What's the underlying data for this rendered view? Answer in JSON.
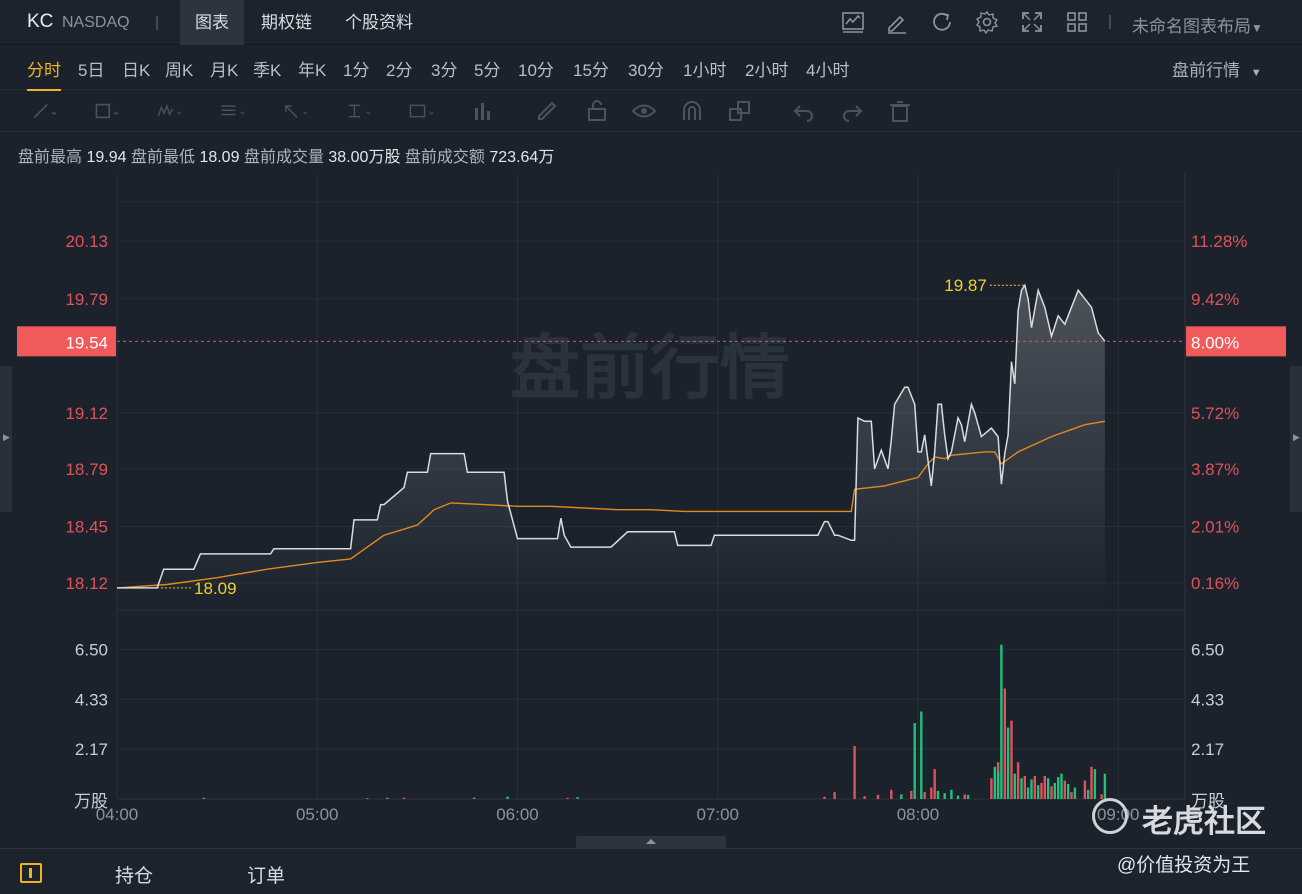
{
  "header": {
    "symbol": "KC",
    "exchange": "NASDAQ",
    "separator": "|",
    "tabs": [
      {
        "label": "图表",
        "active": true
      },
      {
        "label": "期权链",
        "active": false
      },
      {
        "label": "个股资料",
        "active": false
      }
    ],
    "toolbar_icons": [
      "indicator-icon",
      "edit-icon",
      "refresh-icon",
      "settings-icon",
      "fullscreen-icon",
      "grid-layout-icon"
    ],
    "layout_label": "未命名图表布局"
  },
  "timeframes": {
    "items": [
      "分时",
      "5日",
      "日K",
      "周K",
      "月K",
      "季K",
      "年K",
      "1分",
      "2分",
      "3分",
      "5分",
      "10分",
      "15分",
      "30分",
      "1小时",
      "2小时",
      "4小时"
    ],
    "active": "分时",
    "session_label": "盘前行情"
  },
  "drawing_tools": [
    "line-tool-icon",
    "rectangle-tool-icon",
    "pattern-tool-icon",
    "fib-tool-icon",
    "arrow-tool-icon",
    "measure-tool-icon",
    "text-tool-icon",
    "volume-profile-icon",
    "pen-icon",
    "lock-icon",
    "eye-icon",
    "magnet-icon",
    "clone-icon",
    "undo-icon",
    "redo-icon",
    "trash-icon"
  ],
  "stats": {
    "high_label": "盘前最高",
    "high": "19.94",
    "low_label": "盘前最低",
    "low": "18.09",
    "vol_label": "盘前成交量",
    "vol": "38.00万股",
    "amt_label": "盘前成交额",
    "amt": "723.64万"
  },
  "colors": {
    "price_line": "#d8dbe0",
    "avg_line": "#e08a1e",
    "axis_red": "#e0525a",
    "up_bar": "#e0525a",
    "down_bar": "#22c07a",
    "highlight": "#f0d02a"
  },
  "chart_data": {
    "type": "line",
    "watermark": "盘前行情",
    "x_ticks": [
      "04:00",
      "05:00",
      "06:00",
      "07:00",
      "08:00",
      "09:00"
    ],
    "price_ticks": [
      "20.13",
      "19.79",
      "19.12",
      "18.79",
      "18.45",
      "18.12"
    ],
    "pct_ticks": [
      "11.28%",
      "9.42%",
      "5.72%",
      "3.87%",
      "2.01%",
      "0.16%"
    ],
    "current_price": "19.54",
    "current_pct": "8.00%",
    "max_label": "19.87",
    "min_label": "18.09",
    "ylim": [
      17.96,
      20.53
    ],
    "price_series": {
      "name": "price",
      "time": [
        "04:00",
        "04:12",
        "04:14",
        "04:23",
        "04:25",
        "04:46",
        "04:47",
        "04:56",
        "04:57",
        "05:10",
        "05:11",
        "05:12",
        "05:18",
        "05:19",
        "05:20",
        "05:26",
        "05:27",
        "05:33",
        "05:34",
        "05:37",
        "05:38",
        "05:44",
        "05:45",
        "05:56",
        "05:57",
        "06:00",
        "06:12",
        "06:13",
        "06:14",
        "06:16",
        "06:17",
        "06:28",
        "06:33",
        "06:35",
        "06:37",
        "06:40",
        "06:42",
        "06:47",
        "06:48",
        "06:58",
        "06:59",
        "07:00",
        "07:30",
        "07:32",
        "07:33",
        "07:35",
        "07:36",
        "07:40",
        "07:41",
        "07:42",
        "07:44",
        "07:46",
        "07:47",
        "07:49",
        "07:51",
        "07:52",
        "07:53",
        "07:56",
        "07:57",
        "07:59",
        "08:00",
        "08:01",
        "08:02",
        "08:04",
        "08:05",
        "08:06",
        "08:07",
        "08:08",
        "08:09",
        "08:10",
        "08:12",
        "08:13",
        "08:14",
        "08:16",
        "08:17",
        "08:19",
        "08:22",
        "08:24",
        "08:25",
        "08:26",
        "08:27",
        "08:28",
        "08:29",
        "08:30",
        "08:31",
        "08:32",
        "08:33",
        "08:34",
        "08:36",
        "08:38",
        "08:40",
        "08:42",
        "08:44",
        "08:46",
        "08:48",
        "08:50",
        "08:52",
        "08:54",
        "08:56"
      ],
      "values": [
        18.09,
        18.09,
        18.2,
        18.2,
        18.29,
        18.29,
        18.32,
        18.32,
        18.32,
        18.32,
        18.49,
        18.49,
        18.49,
        18.58,
        18.58,
        18.68,
        18.77,
        18.77,
        18.88,
        18.88,
        18.88,
        18.88,
        18.77,
        18.77,
        18.6,
        18.38,
        18.38,
        18.5,
        18.4,
        18.33,
        18.33,
        18.33,
        18.42,
        18.42,
        18.42,
        18.42,
        18.42,
        18.42,
        18.34,
        18.34,
        18.4,
        18.4,
        18.4,
        18.48,
        18.48,
        18.4,
        18.4,
        18.37,
        18.37,
        19.09,
        19.07,
        19.07,
        18.79,
        18.9,
        18.79,
        18.96,
        19.17,
        19.27,
        19.27,
        19.17,
        18.89,
        18.89,
        18.99,
        18.69,
        18.89,
        19.17,
        19.17,
        18.99,
        18.85,
        18.89,
        19.09,
        19.05,
        18.95,
        19.17,
        19.12,
        18.98,
        19.03,
        18.98,
        18.7,
        18.88,
        18.99,
        19.42,
        19.29,
        19.72,
        19.84,
        19.87,
        19.79,
        19.62,
        19.84,
        19.74,
        19.57,
        19.69,
        19.64,
        19.74,
        19.84,
        19.79,
        19.74,
        19.59,
        19.54
      ]
    },
    "avg_series": {
      "name": "avg",
      "time": [
        "04:00",
        "04:15",
        "04:30",
        "04:45",
        "05:00",
        "05:10",
        "05:15",
        "05:20",
        "05:30",
        "05:35",
        "05:40",
        "05:50",
        "06:00",
        "06:10",
        "06:20",
        "06:30",
        "06:40",
        "06:50",
        "07:00",
        "07:20",
        "07:40",
        "07:41",
        "07:50",
        "08:00",
        "08:03",
        "08:05",
        "08:08",
        "08:10",
        "08:15",
        "08:20",
        "08:23",
        "08:25",
        "08:30",
        "08:40",
        "08:50",
        "08:56"
      ],
      "values": [
        18.09,
        18.11,
        18.15,
        18.2,
        18.24,
        18.26,
        18.33,
        18.4,
        18.46,
        18.55,
        18.59,
        18.58,
        18.57,
        18.57,
        18.56,
        18.55,
        18.55,
        18.54,
        18.54,
        18.54,
        18.54,
        18.67,
        18.69,
        18.74,
        18.82,
        18.86,
        18.85,
        18.87,
        18.88,
        18.89,
        18.89,
        18.82,
        18.89,
        18.98,
        19.05,
        19.07
      ]
    },
    "volume": {
      "ylabel": "万股",
      "ticks": [
        "6.50",
        "4.33",
        "2.17"
      ],
      "ylim": [
        0,
        7.6
      ],
      "bars": [
        {
          "t": "04:26",
          "v": 0.05,
          "d": "down"
        },
        {
          "t": "05:15",
          "v": 0.04,
          "d": "up"
        },
        {
          "t": "05:21",
          "v": 0.05,
          "d": "down"
        },
        {
          "t": "05:26",
          "v": 0.06,
          "d": "up"
        },
        {
          "t": "05:47",
          "v": 0.06,
          "d": "down"
        },
        {
          "t": "05:57",
          "v": 0.1,
          "d": "down"
        },
        {
          "t": "06:15",
          "v": 0.05,
          "d": "up"
        },
        {
          "t": "06:18",
          "v": 0.08,
          "d": "down"
        },
        {
          "t": "07:32",
          "v": 0.1,
          "d": "up"
        },
        {
          "t": "07:35",
          "v": 0.3,
          "d": "up"
        },
        {
          "t": "07:41",
          "v": 2.3,
          "d": "up"
        },
        {
          "t": "07:44",
          "v": 0.12,
          "d": "up"
        },
        {
          "t": "07:48",
          "v": 0.18,
          "d": "up"
        },
        {
          "t": "07:52",
          "v": 0.4,
          "d": "up"
        },
        {
          "t": "07:55",
          "v": 0.2,
          "d": "down"
        },
        {
          "t": "07:58",
          "v": 0.35,
          "d": "up"
        },
        {
          "t": "07:59",
          "v": 3.3,
          "d": "down"
        },
        {
          "t": "08:01",
          "v": 3.8,
          "d": "down"
        },
        {
          "t": "08:02",
          "v": 0.3,
          "d": "up"
        },
        {
          "t": "08:04",
          "v": 0.5,
          "d": "up"
        },
        {
          "t": "08:05",
          "v": 1.3,
          "d": "up"
        },
        {
          "t": "08:06",
          "v": 0.35,
          "d": "down"
        },
        {
          "t": "08:08",
          "v": 0.25,
          "d": "down"
        },
        {
          "t": "08:10",
          "v": 0.4,
          "d": "down"
        },
        {
          "t": "08:12",
          "v": 0.15,
          "d": "down"
        },
        {
          "t": "08:14",
          "v": 0.2,
          "d": "up"
        },
        {
          "t": "08:15",
          "v": 0.18,
          "d": "down"
        },
        {
          "t": "08:22",
          "v": 0.9,
          "d": "up"
        },
        {
          "t": "08:23",
          "v": 1.4,
          "d": "down"
        },
        {
          "t": "08:24",
          "v": 1.6,
          "d": "up"
        },
        {
          "t": "08:24",
          "v": 1.2,
          "d": "down"
        },
        {
          "t": "08:25",
          "v": 6.7,
          "d": "down"
        },
        {
          "t": "08:26",
          "v": 4.8,
          "d": "up"
        },
        {
          "t": "08:27",
          "v": 3.1,
          "d": "down"
        },
        {
          "t": "08:28",
          "v": 3.4,
          "d": "up"
        },
        {
          "t": "08:29",
          "v": 1.1,
          "d": "down"
        },
        {
          "t": "08:30",
          "v": 1.6,
          "d": "up"
        },
        {
          "t": "08:31",
          "v": 0.9,
          "d": "down"
        },
        {
          "t": "08:32",
          "v": 1.0,
          "d": "up"
        },
        {
          "t": "08:33",
          "v": 0.5,
          "d": "down"
        },
        {
          "t": "08:34",
          "v": 0.85,
          "d": "down"
        },
        {
          "t": "08:35",
          "v": 1.0,
          "d": "up"
        },
        {
          "t": "08:36",
          "v": 0.6,
          "d": "down"
        },
        {
          "t": "08:37",
          "v": 0.7,
          "d": "up"
        },
        {
          "t": "08:38",
          "v": 1.0,
          "d": "up"
        },
        {
          "t": "08:39",
          "v": 0.9,
          "d": "down"
        },
        {
          "t": "08:40",
          "v": 0.55,
          "d": "up"
        },
        {
          "t": "08:41",
          "v": 0.7,
          "d": "down"
        },
        {
          "t": "08:42",
          "v": 0.95,
          "d": "down"
        },
        {
          "t": "08:43",
          "v": 1.1,
          "d": "down"
        },
        {
          "t": "08:44",
          "v": 0.8,
          "d": "up"
        },
        {
          "t": "08:45",
          "v": 0.65,
          "d": "down"
        },
        {
          "t": "08:46",
          "v": 0.3,
          "d": "up"
        },
        {
          "t": "08:47",
          "v": 0.5,
          "d": "down"
        },
        {
          "t": "08:50",
          "v": 0.8,
          "d": "up"
        },
        {
          "t": "08:51",
          "v": 0.4,
          "d": "down"
        },
        {
          "t": "08:52",
          "v": 1.4,
          "d": "up"
        },
        {
          "t": "08:53",
          "v": 1.3,
          "d": "down"
        },
        {
          "t": "08:55",
          "v": 0.2,
          "d": "up"
        },
        {
          "t": "08:56",
          "v": 1.1,
          "d": "down"
        }
      ]
    }
  },
  "bottom": {
    "tabs": [
      "持仓",
      "订单"
    ],
    "brand": "老虎社区",
    "user": "@价值投资为王"
  }
}
